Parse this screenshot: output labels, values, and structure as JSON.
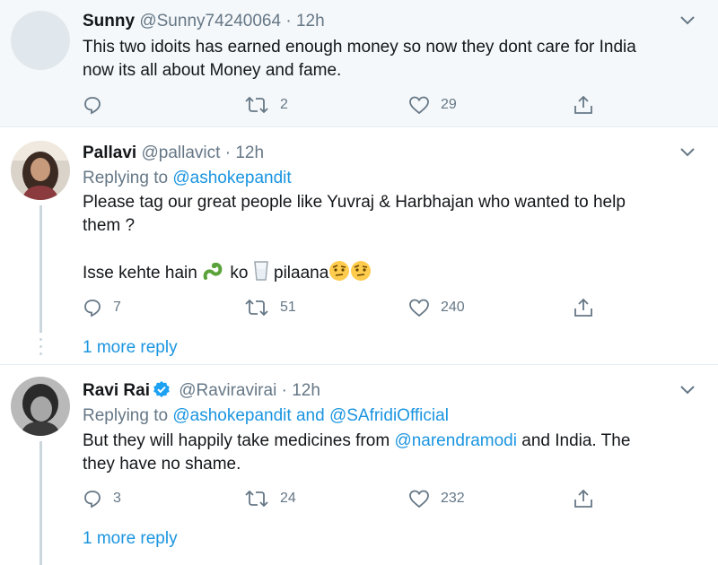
{
  "tweets": [
    {
      "name": "Sunny",
      "handle": "@Sunny74240064",
      "time": "12h",
      "text_lines": [
        "This two idoits has earned enough money so now they dont care for India",
        "now its all about Money and fame."
      ],
      "replies": "",
      "retweets": "2",
      "likes": "29"
    },
    {
      "name": "Pallavi",
      "handle": "@pallavict",
      "time": "12h",
      "replying_prefix": "Replying to",
      "replying_to": "@ashokepandit",
      "text_lines": [
        "Please tag our great people like Yuvraj & Harbhajan who wanted to help",
        "them ?"
      ],
      "line2_a": "Isse kehte hain",
      "line2_b": "ko",
      "line2_c": "pilaana",
      "replies": "7",
      "retweets": "51",
      "likes": "240",
      "more_reply": "1 more reply"
    },
    {
      "name": "Ravi Rai",
      "handle": "@Raviravirai",
      "time": "12h",
      "verified": true,
      "replying_prefix": "Replying to",
      "replying_to_1": "@ashokepandit",
      "replying_and": "and",
      "replying_to_2": "@SAfridiOfficial",
      "text_a": "But they will happily take medicines from",
      "text_mention": "@narendramodi",
      "text_b": "and India. The",
      "text_line2": "they have no shame.",
      "replies": "3",
      "retweets": "24",
      "likes": "232",
      "more_reply": "1 more reply"
    }
  ],
  "separator": "·",
  "icons": [
    "reply-icon",
    "retweet-icon",
    "like-icon",
    "share-icon",
    "caret-down-icon",
    "verified-badge-icon",
    "snake-emoji",
    "milk-glass-emoji",
    "raised-eyebrow-emoji"
  ],
  "colors": {
    "link": "#1b95e0",
    "muted": "#657786",
    "highlight_bg": "#f5f8fa"
  }
}
